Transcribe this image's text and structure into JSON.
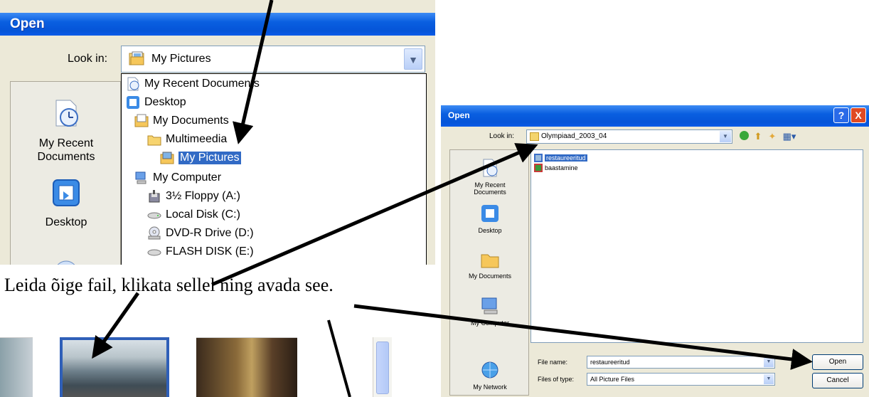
{
  "left_dialog": {
    "title": "Open",
    "look_in_label": "Look in:",
    "look_in_value": "My Pictures",
    "places": [
      {
        "label": "My Recent Documents",
        "icon": "recent-documents-icon"
      },
      {
        "label": "Desktop",
        "icon": "desktop-icon"
      },
      {
        "label": "",
        "icon": "my-documents-icon"
      }
    ],
    "tree": [
      {
        "label": "My Recent Documents",
        "icon": "recent-documents-icon"
      },
      {
        "label": "Desktop",
        "icon": "desktop-icon"
      },
      {
        "label": "My Documents",
        "icon": "my-documents-icon"
      },
      {
        "label": "Multimeedia",
        "icon": "folder-icon"
      },
      {
        "label": "My Pictures",
        "icon": "my-pictures-icon",
        "selected": true
      },
      {
        "label": "My Computer",
        "icon": "my-computer-icon"
      },
      {
        "label": "3½ Floppy (A:)",
        "icon": "floppy-icon"
      },
      {
        "label": "Local Disk (C:)",
        "icon": "hard-disk-icon"
      },
      {
        "label": "DVD-R Drive (D:)",
        "icon": "dvd-drive-icon"
      },
      {
        "label": "FLASH DISK (E:)",
        "icon": "removable-disk-icon"
      }
    ]
  },
  "right_dialog": {
    "title": "Open",
    "help": "?",
    "close": "X",
    "look_in_label": "Look in:",
    "look_in_value": "Olympiaad_2003_04",
    "places": [
      {
        "label": "My Recent Documents"
      },
      {
        "label": "Desktop"
      },
      {
        "label": "My Documents"
      },
      {
        "label": "My Computer"
      },
      {
        "label": "My Network"
      }
    ],
    "files": [
      {
        "name": "restaureeritud",
        "selected": true
      },
      {
        "name": "baastamine",
        "selected": false
      }
    ],
    "file_name_label": "File name:",
    "file_name_value": "restaureeritud",
    "file_type_label": "Files of type:",
    "file_type_value": "All Picture Files",
    "open_button": "Open",
    "cancel_button": "Cancel"
  },
  "caption": "Leida õige fail, klikata sellel ning avada see.",
  "colors": {
    "xp_blue": "#0554d8",
    "selection": "#316ac5",
    "dialog_bg": "#ece9d8"
  }
}
